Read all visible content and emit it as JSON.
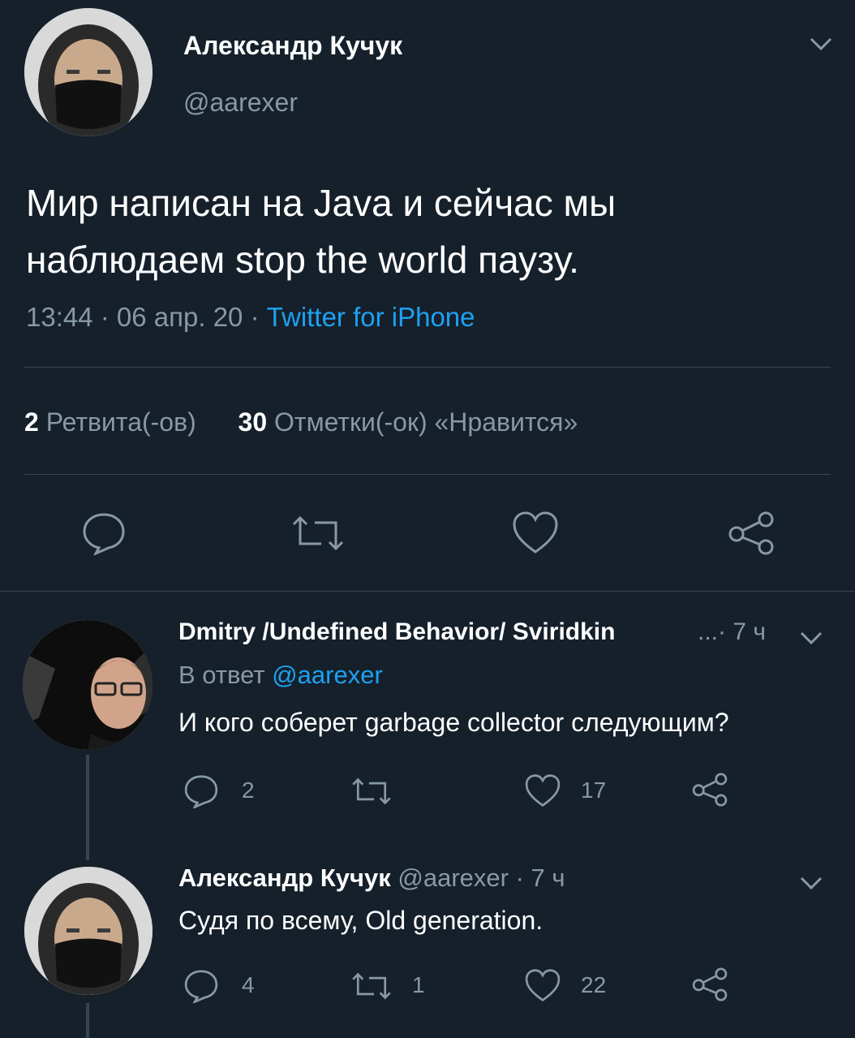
{
  "main_tweet": {
    "author_name": "Александр Кучук",
    "author_handle": "@aarexer",
    "text_line1": "Мир написан на Java и сейчас мы",
    "text_line2": "наблюдаем stop the world паузу.",
    "time_date": "13:44 · 06 апр. 20 · ",
    "source": "Twitter for iPhone",
    "retweets_count": "2",
    "retweets_label": "Ретвита(-ов)",
    "likes_count": "30",
    "likes_label": "Отметки(-ок) «Нравится»"
  },
  "reply1": {
    "author_name": "Dmitry /Undefined Behavior/ Sviridkin",
    "ellipsis_time": "...· 7 ч",
    "reply_to_label": "В ответ",
    "reply_to_handle": "@aarexer",
    "text": "И кого соберет garbage collector следующим?",
    "reply_count": "2",
    "retweet_count": "",
    "like_count": "17"
  },
  "reply2": {
    "author_name": "Александр Кучук",
    "meta": "@aarexer · 7 ч",
    "text": "Судя по всему, Old generation.",
    "reply_count": "4",
    "retweet_count": "1",
    "like_count": "22"
  },
  "colors": {
    "background": "#15202b",
    "text": "#ffffff",
    "muted": "#8899a6",
    "link": "#1da1f2",
    "divider": "#38444d"
  }
}
